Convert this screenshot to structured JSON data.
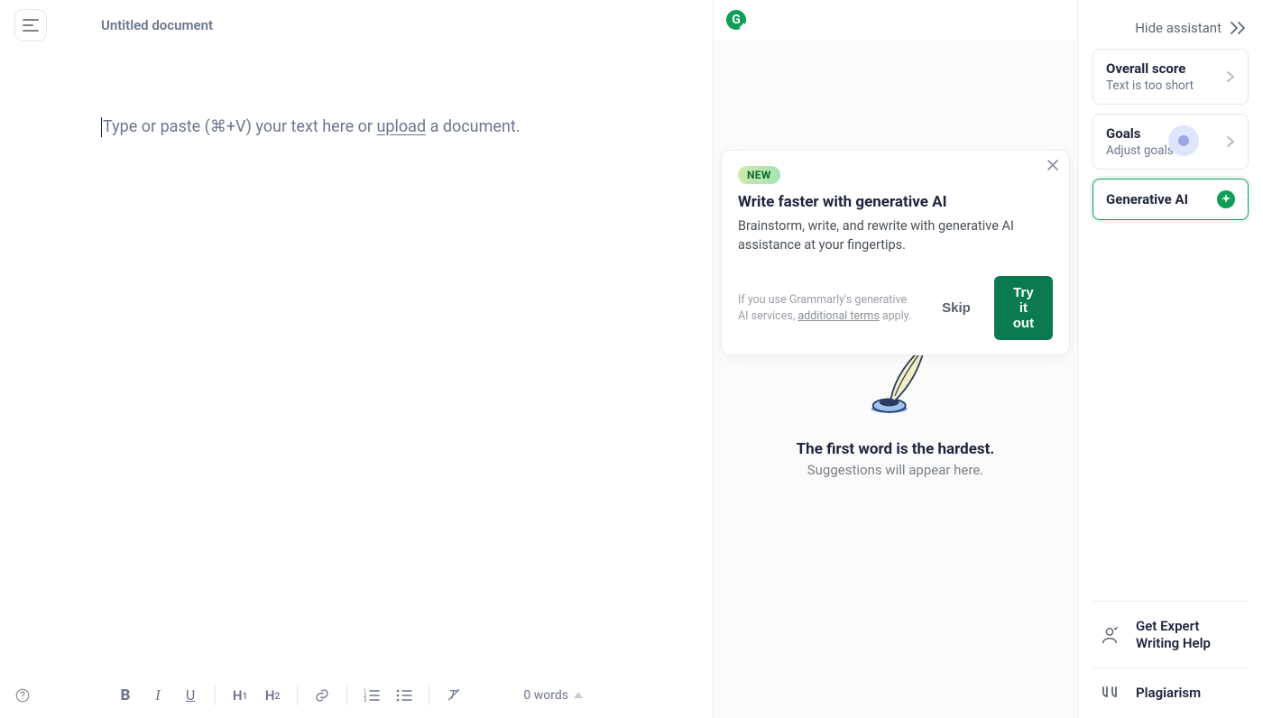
{
  "editor": {
    "title": "Untitled document",
    "placeholder_pre": "Type or paste (⌘+V) your text here or ",
    "placeholder_link": "upload",
    "placeholder_post": " a document.",
    "word_count": "0 words",
    "toolbar": {
      "h1": "H",
      "h2": "H"
    }
  },
  "assistant": {
    "promo": {
      "badge": "NEW",
      "title": "Write faster with generative AI",
      "desc": "Brainstorm, write, and rewrite with generative AI assistance at your fingertips.",
      "legal_pre": "If you use Grammarly's generative AI services, ",
      "legal_link": "additional terms",
      "legal_post": " apply.",
      "skip": "Skip",
      "try": "Try it out"
    },
    "empty": {
      "title": "The first word is the hardest.",
      "sub": "Suggestions will appear here."
    }
  },
  "sidebar": {
    "hide": "Hide assistant",
    "overall": {
      "title": "Overall score",
      "sub": "Text is too short"
    },
    "goals": {
      "title": "Goals",
      "sub": "Adjust goals"
    },
    "gen": {
      "title": "Generative AI"
    },
    "footer": {
      "expert": "Get Expert Writing Help",
      "plagiarism": "Plagiarism"
    }
  }
}
